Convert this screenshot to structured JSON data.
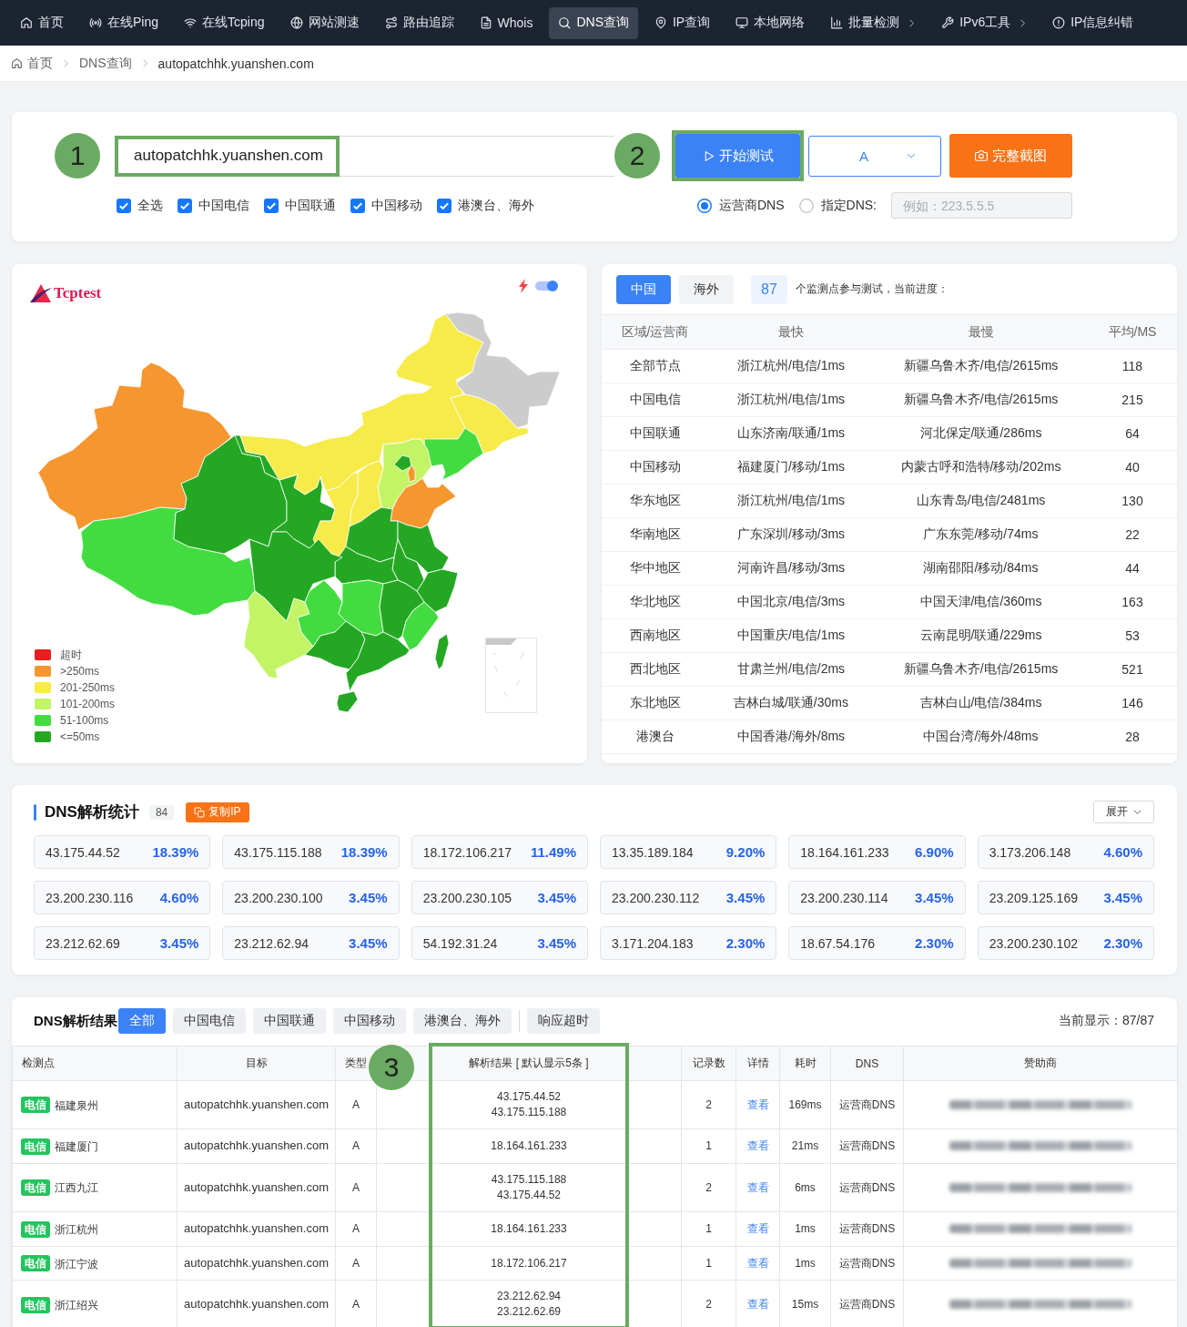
{
  "nav": {
    "items": [
      {
        "label": "首页",
        "selected": false,
        "submenu": false
      },
      {
        "label": "在线Ping",
        "selected": false,
        "submenu": false
      },
      {
        "label": "在线Tcping",
        "selected": false,
        "submenu": false
      },
      {
        "label": "网站测速",
        "selected": false,
        "submenu": false
      },
      {
        "label": "路由追踪",
        "selected": false,
        "submenu": false
      },
      {
        "label": "Whois",
        "selected": false,
        "submenu": false
      },
      {
        "label": "DNS查询",
        "selected": true,
        "submenu": false
      },
      {
        "label": "IP查询",
        "selected": false,
        "submenu": false
      },
      {
        "label": "本地网络",
        "selected": false,
        "submenu": false
      },
      {
        "label": "批量检测",
        "selected": false,
        "submenu": true
      },
      {
        "label": "IPv6工具",
        "selected": false,
        "submenu": true
      },
      {
        "label": "IP信息纠错",
        "selected": false,
        "submenu": false
      }
    ]
  },
  "breadcrumb": [
    "首页",
    "DNS查询",
    "autopatchhk.yuanshen.com"
  ],
  "query": {
    "domain": {
      "value": "autopatchhk.yuanshen.com",
      "highlighted": true,
      "callout": "1"
    },
    "start_button": {
      "label": "开始测试",
      "highlighted": true,
      "callout": "2"
    },
    "record_type": {
      "value": "A"
    },
    "screenshot_button": {
      "label": "完整截图"
    },
    "isp_filters": [
      {
        "label": "全选",
        "checked": true
      },
      {
        "label": "中国电信",
        "checked": true
      },
      {
        "label": "中国联通",
        "checked": true
      },
      {
        "label": "中国移动",
        "checked": true
      },
      {
        "label": "港澳台、海外",
        "checked": true
      }
    ],
    "dns_modes": [
      {
        "label": "运营商DNS",
        "selected": true
      },
      {
        "label": "指定DNS:",
        "selected": false
      }
    ],
    "custom_dns": {
      "placeholder": "例如：223.5.5.5",
      "disabled": true
    }
  },
  "map_panel": {
    "logo": "Tcptest",
    "toggle": {
      "on": true
    },
    "regions": [
      {
        "color": "#f5962f"
      },
      {
        "color": "#43dc40"
      },
      {
        "color": "#24a823"
      },
      {
        "color": "#24a823"
      },
      {
        "color": "#f6eb49"
      },
      {
        "color": "#cccccc"
      },
      {
        "color": "#f6eb49"
      },
      {
        "color": "#43dc40"
      },
      {
        "color": "#c3f465"
      },
      {
        "color": "#24a823"
      },
      {
        "color": "#f5962f"
      },
      {
        "color": "#f6eb49"
      },
      {
        "color": "#f6eb49"
      },
      {
        "color": "#f5962f"
      },
      {
        "color": "#24a823"
      },
      {
        "color": "#24a823"
      },
      {
        "color": "#24a823"
      },
      {
        "color": "#24a823"
      },
      {
        "color": "#24a823"
      },
      {
        "color": "#24a823"
      },
      {
        "color": "#c3f465"
      },
      {
        "color": "#43dc40"
      },
      {
        "color": "#43dc40"
      },
      {
        "color": "#24a823"
      },
      {
        "color": "#43dc40"
      },
      {
        "color": "#24a823"
      },
      {
        "color": "#24a823"
      },
      {
        "color": "#24a823"
      },
      {
        "color": "#24a823"
      }
    ],
    "legend": [
      {
        "label": "超时",
        "color": "#e81d1d"
      },
      {
        "label": ">250ms",
        "color": "#f5962f"
      },
      {
        "label": "201-250ms",
        "color": "#f6eb49"
      },
      {
        "label": "101-200ms",
        "color": "#c3f465"
      },
      {
        "label": "51-100ms",
        "color": "#43dc40"
      },
      {
        "label": "<=50ms",
        "color": "#24a823"
      }
    ]
  },
  "summary": {
    "tabs": [
      {
        "label": "中国",
        "selected": true
      },
      {
        "label": "海外",
        "selected": false
      }
    ],
    "node_count": "87",
    "progress_text": "个监测点参与测试，当前进度：",
    "columns": [
      "区域/运营商",
      "最快",
      "最慢",
      "平均/MS"
    ],
    "rows": [
      [
        "全部节点",
        "浙江杭州/电信/1ms",
        "新疆乌鲁木齐/电信/2615ms",
        "118"
      ],
      [
        "中国电信",
        "浙江杭州/电信/1ms",
        "新疆乌鲁木齐/电信/2615ms",
        "215"
      ],
      [
        "中国联通",
        "山东济南/联通/1ms",
        "河北保定/联通/286ms",
        "64"
      ],
      [
        "中国移动",
        "福建厦门/移动/1ms",
        "内蒙古呼和浩特/移动/202ms",
        "40"
      ],
      [
        "华东地区",
        "浙江杭州/电信/1ms",
        "山东青岛/电信/2481ms",
        "130"
      ],
      [
        "华南地区",
        "广东深圳/移动/3ms",
        "广东东莞/移动/74ms",
        "22"
      ],
      [
        "华中地区",
        "河南许昌/移动/3ms",
        "湖南邵阳/移动/84ms",
        "44"
      ],
      [
        "华北地区",
        "中国北京/电信/3ms",
        "中国天津/电信/360ms",
        "163"
      ],
      [
        "西南地区",
        "中国重庆/电信/1ms",
        "云南昆明/联通/229ms",
        "53"
      ],
      [
        "西北地区",
        "甘肃兰州/电信/2ms",
        "新疆乌鲁木齐/电信/2615ms",
        "521"
      ],
      [
        "东北地区",
        "吉林白城/联通/30ms",
        "吉林白山/电信/384ms",
        "146"
      ],
      [
        "港澳台",
        "中国香港/海外/8ms",
        "中国台湾/海外/48ms",
        "28"
      ]
    ]
  },
  "stats": {
    "title": "DNS解析统计",
    "count": "84",
    "copy_button": "复制IP",
    "expand_button": "展开",
    "items": [
      {
        "ip": "43.175.44.52",
        "share": "18.39%"
      },
      {
        "ip": "43.175.115.188",
        "share": "18.39%"
      },
      {
        "ip": "18.172.106.217",
        "share": "11.49%"
      },
      {
        "ip": "13.35.189.184",
        "share": "9.20%"
      },
      {
        "ip": "18.164.161.233",
        "share": "6.90%"
      },
      {
        "ip": "3.173.206.148",
        "share": "4.60%"
      },
      {
        "ip": "23.200.230.116",
        "share": "4.60%"
      },
      {
        "ip": "23.200.230.100",
        "share": "3.45%"
      },
      {
        "ip": "23.200.230.105",
        "share": "3.45%"
      },
      {
        "ip": "23.200.230.112",
        "share": "3.45%"
      },
      {
        "ip": "23.200.230.114",
        "share": "3.45%"
      },
      {
        "ip": "23.209.125.169",
        "share": "3.45%"
      },
      {
        "ip": "23.212.62.69",
        "share": "3.45%"
      },
      {
        "ip": "23.212.62.94",
        "share": "3.45%"
      },
      {
        "ip": "54.192.31.24",
        "share": "3.45%"
      },
      {
        "ip": "3.171.204.183",
        "share": "2.30%"
      },
      {
        "ip": "18.67.54.176",
        "share": "2.30%"
      },
      {
        "ip": "23.200.230.102",
        "share": "2.30%"
      }
    ]
  },
  "results": {
    "title": "DNS解析结果",
    "filters": [
      {
        "label": "全部",
        "selected": true,
        "kind": "isp"
      },
      {
        "label": "中国电信",
        "selected": false,
        "kind": "isp"
      },
      {
        "label": "中国联通",
        "selected": false,
        "kind": "isp"
      },
      {
        "label": "中国移动",
        "selected": false,
        "kind": "isp"
      },
      {
        "label": "港澳台、海外",
        "selected": false,
        "kind": "isp"
      },
      {
        "label": "响应超时",
        "selected": false,
        "kind": "status"
      }
    ],
    "shown": "当前显示：87/87",
    "columns": [
      {
        "label": "检测点",
        "highlighted": false
      },
      {
        "label": "目标",
        "highlighted": false
      },
      {
        "label": "类型",
        "highlighted": false
      },
      {
        "label": "解析结果 [ 默认显示5条 ]",
        "highlighted": true,
        "callout": "3"
      },
      {
        "label": "记录数",
        "highlighted": false
      },
      {
        "label": "详情",
        "highlighted": false
      },
      {
        "label": "耗时",
        "highlighted": false
      },
      {
        "label": "DNS",
        "highlighted": false
      },
      {
        "label": "赞助商",
        "highlighted": false
      }
    ],
    "rows": [
      {
        "isp": "电信",
        "location": "福建泉州",
        "target": "autopatchhk.yuanshen.com",
        "type": "A",
        "answers": [
          "43.175.44.52",
          "43.175.115.188"
        ],
        "records": "2",
        "detail": "查看",
        "time": "169ms",
        "dns": "运营商DNS"
      },
      {
        "isp": "电信",
        "location": "福建厦门",
        "target": "autopatchhk.yuanshen.com",
        "type": "A",
        "answers": [
          "18.164.161.233"
        ],
        "records": "1",
        "detail": "查看",
        "time": "21ms",
        "dns": "运营商DNS"
      },
      {
        "isp": "电信",
        "location": "江西九江",
        "target": "autopatchhk.yuanshen.com",
        "type": "A",
        "answers": [
          "43.175.115.188",
          "43.175.44.52"
        ],
        "records": "2",
        "detail": "查看",
        "time": "6ms",
        "dns": "运营商DNS"
      },
      {
        "isp": "电信",
        "location": "浙江杭州",
        "target": "autopatchhk.yuanshen.com",
        "type": "A",
        "answers": [
          "18.164.161.233"
        ],
        "records": "1",
        "detail": "查看",
        "time": "1ms",
        "dns": "运营商DNS"
      },
      {
        "isp": "电信",
        "location": "浙江宁波",
        "target": "autopatchhk.yuanshen.com",
        "type": "A",
        "answers": [
          "18.172.106.217"
        ],
        "records": "1",
        "detail": "查看",
        "time": "1ms",
        "dns": "运营商DNS"
      },
      {
        "isp": "电信",
        "location": "浙江绍兴",
        "target": "autopatchhk.yuanshen.com",
        "type": "A",
        "answers": [
          "23.212.62.94",
          "23.212.62.69"
        ],
        "records": "2",
        "detail": "查看",
        "time": "15ms",
        "dns": "运营商DNS"
      }
    ]
  }
}
